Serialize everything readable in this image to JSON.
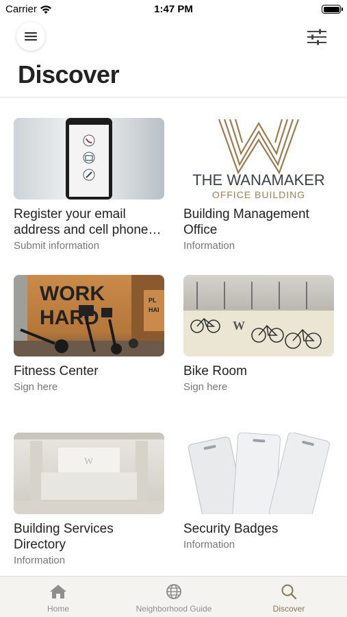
{
  "status_bar": {
    "carrier": "Carrier",
    "time": "1:47 PM",
    "battery_level": 1.0
  },
  "header": {
    "title": "Discover",
    "menu_icon": "hamburger-icon",
    "filter_icon": "sliders-icon"
  },
  "cards": [
    {
      "title": "Register your email address and cell phone…",
      "subtitle": "Submit information"
    },
    {
      "title": "Building Management Office",
      "subtitle": "Information",
      "logo_text": "THE WANAMAKER",
      "logo_subtext": "OFFICE BUILDING"
    },
    {
      "title": "Fitness Center",
      "subtitle": "Sign here",
      "sign_text": "WORK HARD",
      "sign_text_small": "PL HAI"
    },
    {
      "title": "Bike Room",
      "subtitle": "Sign here",
      "wall_logo": "W"
    },
    {
      "title": "Building Services Directory",
      "subtitle": "Information",
      "desk_logo": "W"
    },
    {
      "title": "Security Badges",
      "subtitle": "Information"
    }
  ],
  "tab_bar": {
    "active_color": "#8a7552",
    "items": [
      {
        "label": "Home",
        "icon": "home-icon"
      },
      {
        "label": "Neighborhood Guide",
        "icon": "globe-icon"
      },
      {
        "label": "Discover",
        "icon": "search-icon"
      }
    ]
  }
}
